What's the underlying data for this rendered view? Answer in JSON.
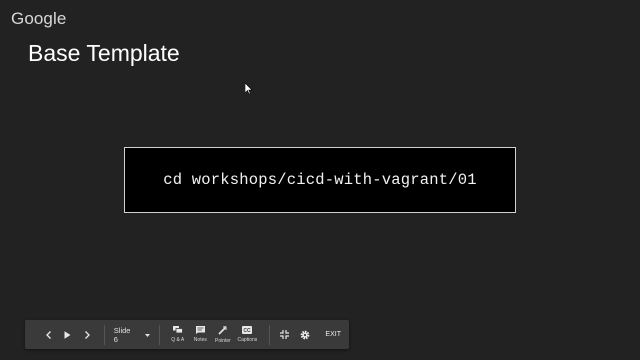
{
  "logo": {
    "text": "Google"
  },
  "slide": {
    "title": "Base Template",
    "command": "cd workshops/cicd-with-vagrant/01"
  },
  "toolbar": {
    "slide_indicator": "Slide 6",
    "tools": [
      {
        "icon": "qa-icon",
        "label": "Q & A"
      },
      {
        "icon": "notes-icon",
        "label": "Notes"
      },
      {
        "icon": "pointer-icon",
        "label": "Pointer"
      },
      {
        "icon": "captions-icon",
        "label": "Captions"
      }
    ],
    "exit_label": "EXIT"
  },
  "colors": {
    "background": "#222222",
    "toolbar": "#3a3a3a",
    "command_box": "#000000",
    "text": "#ffffff"
  }
}
